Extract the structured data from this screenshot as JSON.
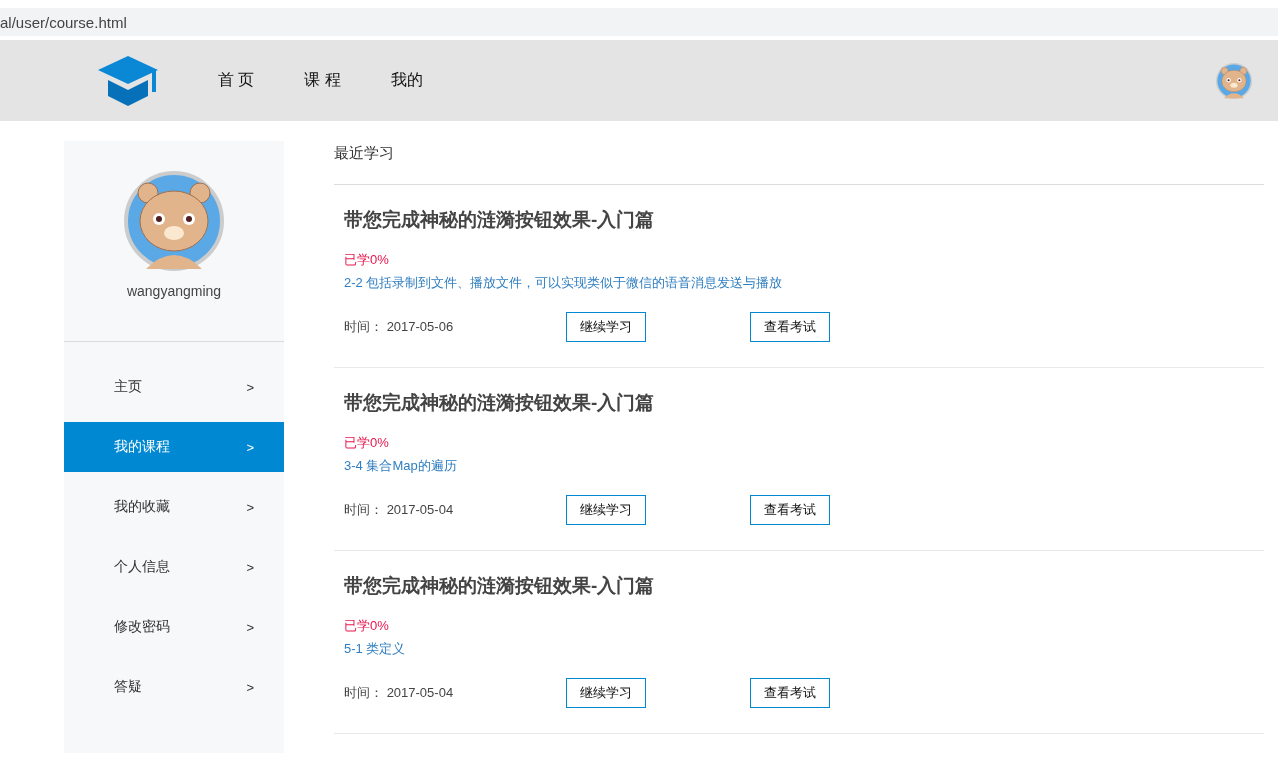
{
  "browser": {
    "url": "al/user/course.html"
  },
  "nav": [
    {
      "label": "首 页",
      "selected": false
    },
    {
      "label": "课 程",
      "selected": false
    },
    {
      "label": "我的",
      "selected": false
    }
  ],
  "profile": {
    "username": "wangyangming"
  },
  "sidebar": {
    "items": [
      {
        "label": "主页",
        "arrow": ">",
        "selected": false
      },
      {
        "label": "我的课程",
        "arrow": ">",
        "selected": true
      },
      {
        "label": "我的收藏",
        "arrow": ">",
        "selected": false
      },
      {
        "label": "个人信息",
        "arrow": ">",
        "selected": false
      },
      {
        "label": "修改密码",
        "arrow": ">",
        "selected": false
      },
      {
        "label": "答疑",
        "arrow": ">",
        "selected": false
      }
    ]
  },
  "section_title": "最近学习",
  "courses": [
    {
      "title": "带您完成神秘的涟漪按钮效果-入门篇",
      "progress": "已学0%",
      "lesson": "2-2 包括录制到文件、播放文件，可以实现类似于微信的语音消息发送与播放",
      "time_label": "时间：",
      "date": "2017-05-06",
      "continue": "继续学习",
      "exam": "查看考试"
    },
    {
      "title": "带您完成神秘的涟漪按钮效果-入门篇",
      "progress": "已学0%",
      "lesson": "3-4 集合Map的遍历",
      "time_label": "时间：",
      "date": "2017-05-04",
      "continue": "继续学习",
      "exam": "查看考试"
    },
    {
      "title": "带您完成神秘的涟漪按钮效果-入门篇",
      "progress": "已学0%",
      "lesson": "5-1 类定义",
      "time_label": "时间：",
      "date": "2017-05-04",
      "continue": "继续学习",
      "exam": "查看考试"
    }
  ]
}
